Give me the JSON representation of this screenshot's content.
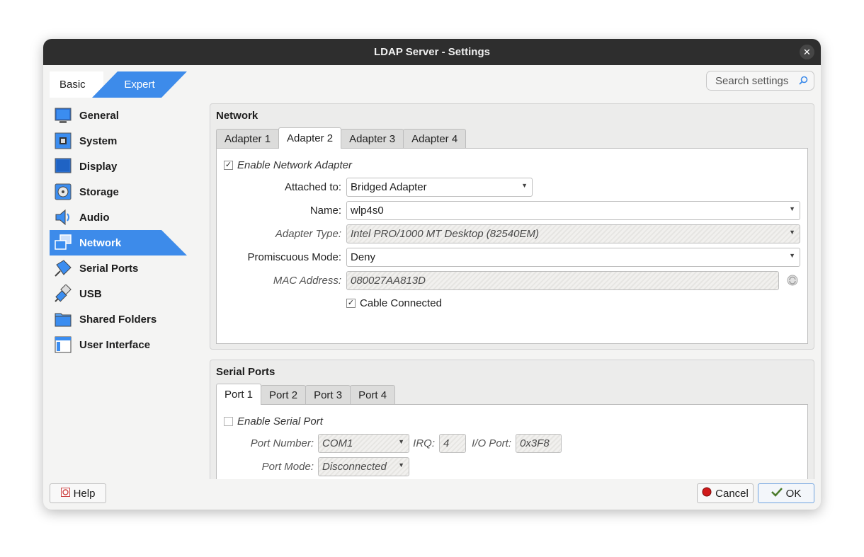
{
  "window": {
    "title": "LDAP Server - Settings"
  },
  "mode": {
    "basic": "Basic",
    "expert": "Expert"
  },
  "search": {
    "placeholder": "Search settings"
  },
  "sidebar": {
    "items": [
      {
        "label": "General",
        "icon": "general-icon"
      },
      {
        "label": "System",
        "icon": "system-icon"
      },
      {
        "label": "Display",
        "icon": "display-icon"
      },
      {
        "label": "Storage",
        "icon": "storage-icon"
      },
      {
        "label": "Audio",
        "icon": "audio-icon"
      },
      {
        "label": "Network",
        "icon": "network-icon",
        "active": true
      },
      {
        "label": "Serial Ports",
        "icon": "serial-ports-icon"
      },
      {
        "label": "USB",
        "icon": "usb-icon"
      },
      {
        "label": "Shared Folders",
        "icon": "shared-folders-icon"
      },
      {
        "label": "User Interface",
        "icon": "user-interface-icon"
      }
    ]
  },
  "network": {
    "title": "Network",
    "tabs": [
      "Adapter 1",
      "Adapter 2",
      "Adapter 3",
      "Adapter 4"
    ],
    "active_tab": "Adapter 2",
    "enable_label": "Enable Network Adapter",
    "enable_checked": true,
    "attached_label": "Attached to:",
    "attached_value": "Bridged Adapter",
    "name_label": "Name:",
    "name_value": "wlp4s0",
    "adapter_type_label": "Adapter Type:",
    "adapter_type_value": "Intel PRO/1000 MT Desktop (82540EM)",
    "promiscuous_label": "Promiscuous Mode:",
    "promiscuous_value": "Deny",
    "mac_label": "MAC Address:",
    "mac_value": "080027AA813D",
    "cable_label": "Cable Connected",
    "cable_checked": true
  },
  "serial": {
    "title": "Serial Ports",
    "tabs": [
      "Port 1",
      "Port 2",
      "Port 3",
      "Port 4"
    ],
    "active_tab": "Port 1",
    "enable_label": "Enable Serial Port",
    "enable_checked": false,
    "port_number_label": "Port Number:",
    "port_number_value": "COM1",
    "irq_label": "IRQ:",
    "irq_value": "4",
    "io_port_label": "I/O Port:",
    "io_port_value": "0x3F8",
    "port_mode_label": "Port Mode:",
    "port_mode_value": "Disconnected"
  },
  "footer": {
    "help": "Help",
    "cancel": "Cancel",
    "ok": "OK"
  },
  "colors": {
    "accent": "#3d8bea",
    "titlebar": "#2e2e2e"
  }
}
